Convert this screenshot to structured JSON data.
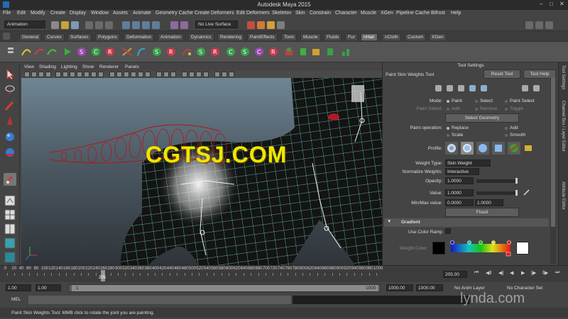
{
  "app": {
    "title": "Autodesk Maya 2015",
    "menu": [
      "File",
      "Edit",
      "Modify",
      "Create",
      "Display",
      "Window",
      "Assets",
      "Animate",
      "Geometry Cache",
      "Create Deformers",
      "Edit Deformers",
      "Skeleton",
      "Skin",
      "Constrain",
      "Character",
      "Muscle",
      "XGen",
      "Pipeline Cache",
      "Bifrost",
      "Help"
    ]
  },
  "status_line": {
    "menu_set": "Animation",
    "live_surface": "No Live Surface"
  },
  "shelf_tabs": [
    "General",
    "Curves",
    "Surfaces",
    "Polygons",
    "Deformation",
    "Animation",
    "Dynamics",
    "Rendering",
    "PaintEffects",
    "Toon",
    "Muscle",
    "Fluids",
    "Fur",
    "nHair",
    "nCloth",
    "Custom",
    "XGen"
  ],
  "active_shelf_tab": "nHair",
  "viewport": {
    "menu": [
      "View",
      "Shading",
      "Lighting",
      "Show",
      "Renderer",
      "Panels"
    ]
  },
  "watermark": "CGTSJ.COM",
  "tool_settings": {
    "panel_title": "Tool Settings",
    "tool_name": "Paint Skin Weights Tool",
    "reset_label": "Reset Tool",
    "help_label": "Tool Help",
    "mode_label": "Mode:",
    "mode_options": [
      "Paint",
      "Select",
      "Paint Select"
    ],
    "paint_select_label": "Paint Select:",
    "paint_select_options": [
      "Add",
      "Remove",
      "Toggle"
    ],
    "select_geometry_label": "Select Geometry",
    "paint_operation_label": "Paint operation:",
    "paint_operation_options": [
      "Replace",
      "Add",
      "Scale",
      "Smooth"
    ],
    "profile_label": "Profile:",
    "weight_type_label": "Weight Type:",
    "weight_type_value": "Skin Weight",
    "normalize_label": "Normalize Weights:",
    "normalize_value": "Interactive",
    "opacity_label": "Opacity:",
    "opacity_value": "1.0000",
    "value_label": "Value:",
    "value_value": "1.0000",
    "minmax_label": "Min/Max value:",
    "min_value": "0.0000",
    "max_value": "1.0000",
    "flood_label": "Flood",
    "gradient_section": "Gradient",
    "use_color_ramp_label": "Use Color Ramp",
    "weight_color_label": "Weight Color:"
  },
  "sidebar_tabs": [
    "Tool Settings",
    "Channel Box / Layer Editor",
    "Attribute Editor"
  ],
  "timeline": {
    "ticks": [
      "0",
      "20",
      "40",
      "60",
      "80",
      "100",
      "120",
      "140",
      "160",
      "180",
      "200",
      "220",
      "240",
      "260",
      "280",
      "300",
      "320",
      "340",
      "360",
      "380",
      "400",
      "420",
      "440",
      "460",
      "480",
      "500",
      "520",
      "540",
      "560",
      "580",
      "600",
      "620",
      "640",
      "660",
      "680",
      "700",
      "720",
      "740",
      "760",
      "780",
      "800",
      "820",
      "840",
      "860",
      "880",
      "900",
      "920",
      "940",
      "960",
      "980",
      "1000"
    ],
    "current_frame": "205",
    "current_frame_field": "205.00"
  },
  "range": {
    "start": "1.00",
    "playback_start": "1.00",
    "slider_start": "1",
    "slider_end": "1000",
    "playback_end": "1000.00",
    "end": "1000.00",
    "anim_layer": "No Anim Layer",
    "character_set": "No Character Set"
  },
  "command_line": {
    "label": "MEL"
  },
  "help_line": "Paint Skin Weights Tool: MMB click to rotate the joint you are painting.",
  "overlay_logo": "lynda.com"
}
